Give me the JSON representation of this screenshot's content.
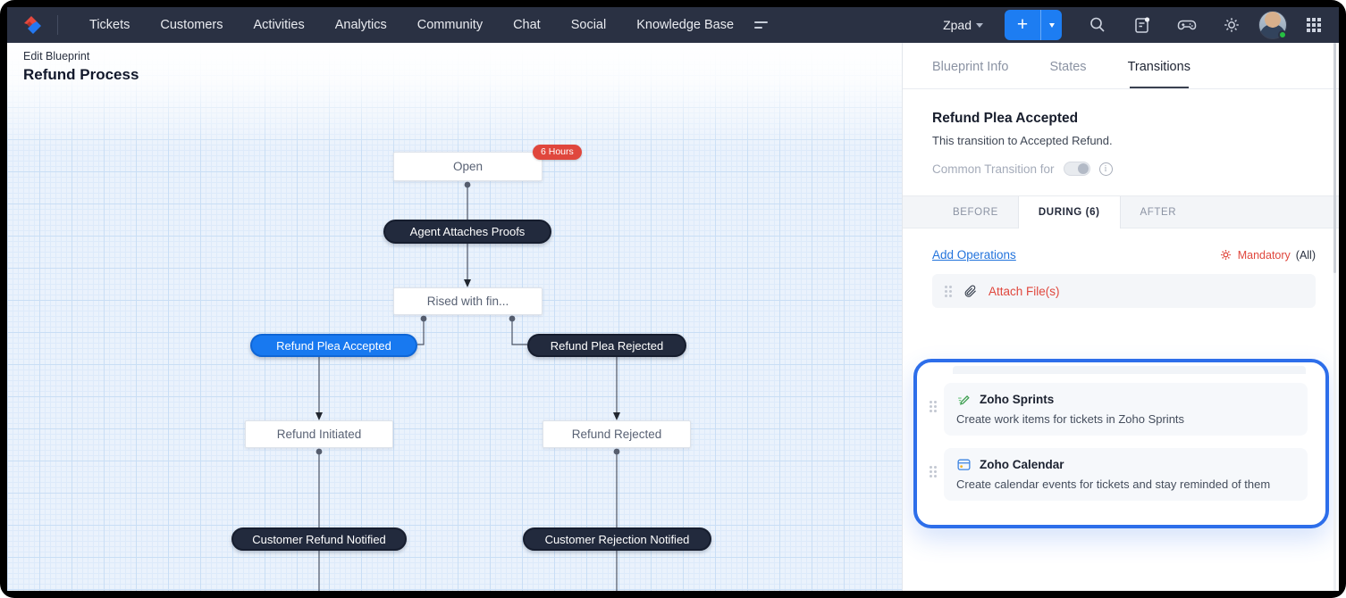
{
  "topnav": {
    "items": [
      "Tickets",
      "Customers",
      "Activities",
      "Analytics",
      "Community",
      "Chat",
      "Social",
      "Knowledge Base"
    ],
    "workspace": "Zpad",
    "icons": [
      "zoho-logo",
      "sort",
      "add",
      "search",
      "feeds",
      "games",
      "settings",
      "avatar",
      "apps-grid"
    ]
  },
  "canvas": {
    "breadcrumb": "Edit Blueprint",
    "title": "Refund Process",
    "badge": "6 Hours",
    "nodes": {
      "open": "Open",
      "agent_attaches_proofs": "Agent Attaches Proofs",
      "rised_with_fin": "Rised with fin...",
      "refund_plea_accepted": "Refund Plea Accepted",
      "refund_plea_rejected": "Refund Plea Rejected",
      "refund_initiated": "Refund Initiated",
      "refund_rejected": "Refund Rejected",
      "customer_refund_notified": "Customer Refund Notified",
      "customer_rejection_notified": "Customer Rejection Notified"
    }
  },
  "panel": {
    "tabs": [
      "Blueprint Info",
      "States",
      "Transitions"
    ],
    "active_tab": "Transitions",
    "transition": {
      "title": "Refund Plea Accepted",
      "description": "This transition to Accepted Refund.",
      "common_label": "Common Transition for"
    },
    "phase_tabs": [
      "BEFORE",
      "DURING (6)",
      "AFTER"
    ],
    "active_phase_tab": "DURING (6)",
    "add_operations": "Add Operations",
    "mandatory_label": "Mandatory",
    "mandatory_suffix": "(All)",
    "operations": [
      {
        "name": "Attach File(s)",
        "icon": "paperclip"
      },
      {
        "name": "Zoho Sprints",
        "icon": "sprints",
        "description": "Create work items for tickets in Zoho Sprints"
      },
      {
        "name": "Zoho Calendar",
        "icon": "calendar",
        "description": "Create calendar events for tickets and stay reminded of them"
      }
    ]
  },
  "colors": {
    "navbar": "#2a3143",
    "accent_blue": "#1d7df2",
    "pill_dark": "#222a3d",
    "pill_blue": "#1879f0",
    "alert_red": "#e0473d",
    "highlight_border": "#2d6eea",
    "canvas_grid": "#c9def5"
  }
}
